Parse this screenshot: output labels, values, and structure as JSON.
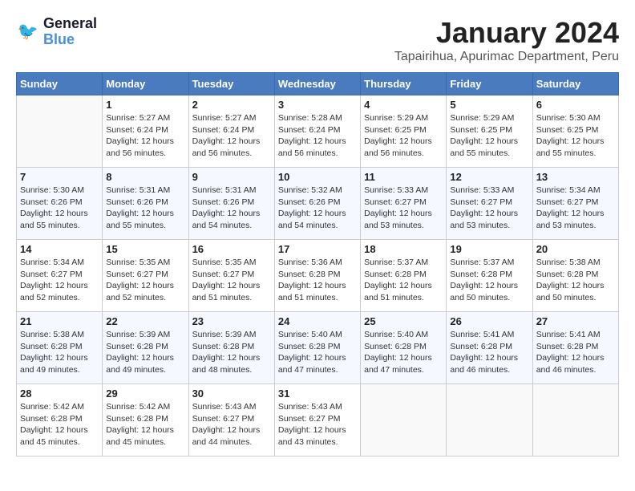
{
  "logo": {
    "line1": "General",
    "line2": "Blue"
  },
  "title": "January 2024",
  "subtitle": "Tapairihua, Apurimac Department, Peru",
  "days_header": [
    "Sunday",
    "Monday",
    "Tuesday",
    "Wednesday",
    "Thursday",
    "Friday",
    "Saturday"
  ],
  "weeks": [
    [
      {
        "day": "",
        "info": ""
      },
      {
        "day": "1",
        "info": "Sunrise: 5:27 AM\nSunset: 6:24 PM\nDaylight: 12 hours\nand 56 minutes."
      },
      {
        "day": "2",
        "info": "Sunrise: 5:27 AM\nSunset: 6:24 PM\nDaylight: 12 hours\nand 56 minutes."
      },
      {
        "day": "3",
        "info": "Sunrise: 5:28 AM\nSunset: 6:24 PM\nDaylight: 12 hours\nand 56 minutes."
      },
      {
        "day": "4",
        "info": "Sunrise: 5:29 AM\nSunset: 6:25 PM\nDaylight: 12 hours\nand 56 minutes."
      },
      {
        "day": "5",
        "info": "Sunrise: 5:29 AM\nSunset: 6:25 PM\nDaylight: 12 hours\nand 55 minutes."
      },
      {
        "day": "6",
        "info": "Sunrise: 5:30 AM\nSunset: 6:25 PM\nDaylight: 12 hours\nand 55 minutes."
      }
    ],
    [
      {
        "day": "7",
        "info": "Sunrise: 5:30 AM\nSunset: 6:26 PM\nDaylight: 12 hours\nand 55 minutes."
      },
      {
        "day": "8",
        "info": "Sunrise: 5:31 AM\nSunset: 6:26 PM\nDaylight: 12 hours\nand 55 minutes."
      },
      {
        "day": "9",
        "info": "Sunrise: 5:31 AM\nSunset: 6:26 PM\nDaylight: 12 hours\nand 54 minutes."
      },
      {
        "day": "10",
        "info": "Sunrise: 5:32 AM\nSunset: 6:26 PM\nDaylight: 12 hours\nand 54 minutes."
      },
      {
        "day": "11",
        "info": "Sunrise: 5:33 AM\nSunset: 6:27 PM\nDaylight: 12 hours\nand 53 minutes."
      },
      {
        "day": "12",
        "info": "Sunrise: 5:33 AM\nSunset: 6:27 PM\nDaylight: 12 hours\nand 53 minutes."
      },
      {
        "day": "13",
        "info": "Sunrise: 5:34 AM\nSunset: 6:27 PM\nDaylight: 12 hours\nand 53 minutes."
      }
    ],
    [
      {
        "day": "14",
        "info": "Sunrise: 5:34 AM\nSunset: 6:27 PM\nDaylight: 12 hours\nand 52 minutes."
      },
      {
        "day": "15",
        "info": "Sunrise: 5:35 AM\nSunset: 6:27 PM\nDaylight: 12 hours\nand 52 minutes."
      },
      {
        "day": "16",
        "info": "Sunrise: 5:35 AM\nSunset: 6:27 PM\nDaylight: 12 hours\nand 51 minutes."
      },
      {
        "day": "17",
        "info": "Sunrise: 5:36 AM\nSunset: 6:28 PM\nDaylight: 12 hours\nand 51 minutes."
      },
      {
        "day": "18",
        "info": "Sunrise: 5:37 AM\nSunset: 6:28 PM\nDaylight: 12 hours\nand 51 minutes."
      },
      {
        "day": "19",
        "info": "Sunrise: 5:37 AM\nSunset: 6:28 PM\nDaylight: 12 hours\nand 50 minutes."
      },
      {
        "day": "20",
        "info": "Sunrise: 5:38 AM\nSunset: 6:28 PM\nDaylight: 12 hours\nand 50 minutes."
      }
    ],
    [
      {
        "day": "21",
        "info": "Sunrise: 5:38 AM\nSunset: 6:28 PM\nDaylight: 12 hours\nand 49 minutes."
      },
      {
        "day": "22",
        "info": "Sunrise: 5:39 AM\nSunset: 6:28 PM\nDaylight: 12 hours\nand 49 minutes."
      },
      {
        "day": "23",
        "info": "Sunrise: 5:39 AM\nSunset: 6:28 PM\nDaylight: 12 hours\nand 48 minutes."
      },
      {
        "day": "24",
        "info": "Sunrise: 5:40 AM\nSunset: 6:28 PM\nDaylight: 12 hours\nand 47 minutes."
      },
      {
        "day": "25",
        "info": "Sunrise: 5:40 AM\nSunset: 6:28 PM\nDaylight: 12 hours\nand 47 minutes."
      },
      {
        "day": "26",
        "info": "Sunrise: 5:41 AM\nSunset: 6:28 PM\nDaylight: 12 hours\nand 46 minutes."
      },
      {
        "day": "27",
        "info": "Sunrise: 5:41 AM\nSunset: 6:28 PM\nDaylight: 12 hours\nand 46 minutes."
      }
    ],
    [
      {
        "day": "28",
        "info": "Sunrise: 5:42 AM\nSunset: 6:28 PM\nDaylight: 12 hours\nand 45 minutes."
      },
      {
        "day": "29",
        "info": "Sunrise: 5:42 AM\nSunset: 6:28 PM\nDaylight: 12 hours\nand 45 minutes."
      },
      {
        "day": "30",
        "info": "Sunrise: 5:43 AM\nSunset: 6:27 PM\nDaylight: 12 hours\nand 44 minutes."
      },
      {
        "day": "31",
        "info": "Sunrise: 5:43 AM\nSunset: 6:27 PM\nDaylight: 12 hours\nand 43 minutes."
      },
      {
        "day": "",
        "info": ""
      },
      {
        "day": "",
        "info": ""
      },
      {
        "day": "",
        "info": ""
      }
    ]
  ]
}
